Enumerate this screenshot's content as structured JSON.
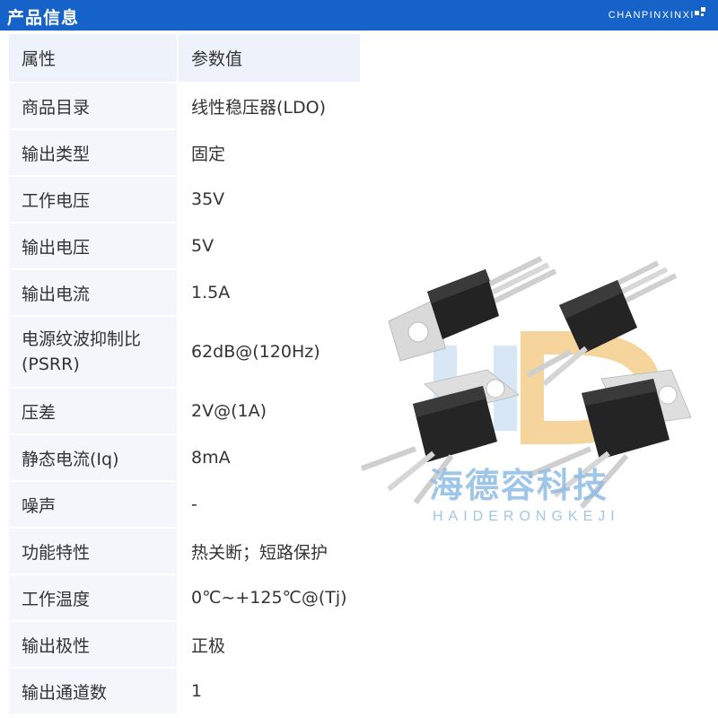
{
  "header": {
    "title": "产品信息",
    "subtitle": "CHANPINXINXI",
    "brand_color": "#1562c9"
  },
  "table": {
    "columns": [
      "属性",
      "参数值"
    ],
    "rows": [
      {
        "key": "商品目录",
        "value": "线性稳压器(LDO)"
      },
      {
        "key": "输出类型",
        "value": "固定"
      },
      {
        "key": "工作电压",
        "value": "35V"
      },
      {
        "key": "输出电压",
        "value": "5V"
      },
      {
        "key": "输出电流",
        "value": "1.5A"
      },
      {
        "key": "电源纹波抑制比(PSRR)",
        "value": "62dB@(120Hz)"
      },
      {
        "key": "压差",
        "value": "2V@(1A)"
      },
      {
        "key": "静态电流(Iq)",
        "value": "8mA"
      },
      {
        "key": "噪声",
        "value": "-"
      },
      {
        "key": "功能特性",
        "value": "热关断；短路保护"
      },
      {
        "key": "工作温度",
        "value": "0℃~+125℃@(Tj)"
      },
      {
        "key": "输出极性",
        "value": "正极"
      },
      {
        "key": "输出通道数",
        "value": "1"
      }
    ]
  },
  "image": {
    "watermark_cn": "海德容科技",
    "watermark_en": "HAIDERONGKEJI",
    "watermark_logo": "HD"
  }
}
